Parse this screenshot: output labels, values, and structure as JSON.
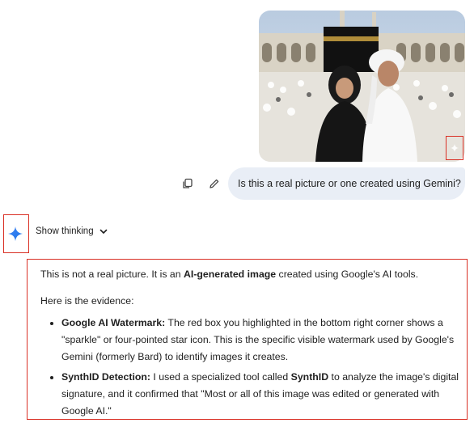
{
  "prompt": {
    "text": "Is this a real picture or one created using Gemini?"
  },
  "actions": {
    "copy_icon": "copy-icon",
    "edit_icon": "pencil-icon"
  },
  "assistant": {
    "icon": "gemini-sparkle-icon",
    "show_thinking": "Show thinking",
    "intro_before": "This is not a real picture. It is an ",
    "intro_bold": "AI-generated image",
    "intro_after": " created using Google's AI tools.",
    "evidence_label": "Here is the evidence:",
    "bullets": [
      {
        "bold": "Google AI Watermark:",
        "text": " The red box you highlighted in the bottom right corner shows a \"sparkle\" or four-pointed star icon. This is the specific visible watermark used by Google's Gemini (formerly Bard) to identify images it creates."
      },
      {
        "bold": "SynthID Detection:",
        "text_before": " I used a specialized tool called ",
        "bold2": "SynthID",
        "text_after": " to analyze the image's digital signature, and it confirmed that \"Most or all of this image was edited or generated with Google AI.\""
      }
    ]
  },
  "colors": {
    "highlight": "#d93025",
    "bubble": "#e9eef6",
    "gemini_blue": "#4285f4"
  }
}
